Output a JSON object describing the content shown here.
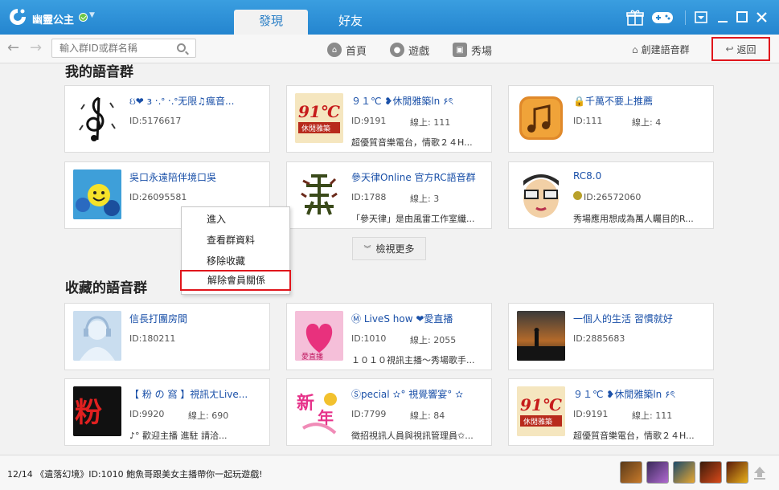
{
  "app": {
    "username": "幽靈公主",
    "logo_icon": "app-logo-icon"
  },
  "tabs": [
    {
      "label": "發現"
    },
    {
      "label": "好友"
    }
  ],
  "toolbar": {
    "search_placeholder": "輸入群ID或群名稱",
    "nav": [
      {
        "label": "首頁",
        "icon": "home-icon"
      },
      {
        "label": "遊戲",
        "icon": "gamepad-icon"
      },
      {
        "label": "秀場",
        "icon": "stage-icon"
      }
    ],
    "create_label": "創建語音群",
    "back_label": "返回"
  },
  "sections": {
    "my_groups_title": "我的語音群",
    "fav_groups_title": "收藏的語音群"
  },
  "my_groups": [
    {
      "name": "ઇ❤ ɜ ‧.ᐤ ‧.ᐤ无限♫瘋音...",
      "id": "ID:5176617",
      "online": "",
      "desc": ""
    },
    {
      "name": "９１℃ ❥休閒雅築ln ۶ৎ",
      "id": "ID:9191",
      "online": "線上: 111",
      "desc": "超優質音樂電台，情歌２４H..."
    },
    {
      "name": "🔒千萬不要上推薦",
      "id": "ID:111",
      "online": "線上: 4",
      "desc": ""
    },
    {
      "name": "吳口永遠陪伴境口吳",
      "id": "ID:26095581",
      "online": "",
      "desc": ""
    },
    {
      "name": "參天律Online 官方RC語音群",
      "id": "ID:1788",
      "online": "線上: 3",
      "desc": "「參天律」是由風雷工作室纖..."
    },
    {
      "name": "RC8.0",
      "id": "ID:26572060",
      "online": "",
      "desc": "秀場應用想成為萬人矚目的R..."
    }
  ],
  "more_label": "檢視更多",
  "context_menu": [
    {
      "label": "進入"
    },
    {
      "label": "查看群資料"
    },
    {
      "label": "移除收藏"
    },
    {
      "label": "解除會員關係"
    }
  ],
  "fav_groups": [
    {
      "name": "信長打團房間",
      "id": "ID:180211",
      "online": "",
      "desc": ""
    },
    {
      "name": "Ⓜ LiveS how ❤愛直播",
      "id": "ID:1010",
      "online": "線上: 2055",
      "desc": "１０１０視訊主播～秀場歌手..."
    },
    {
      "name": "一個人的生活 習慣就好",
      "id": "ID:2885683",
      "online": "",
      "desc": ""
    },
    {
      "name": "【 粉 の 窩 】視訊ㄤLive...",
      "id": "ID:9920",
      "online": "線上: 690",
      "desc": "♪° 歡迎主播 進駐 請洽..."
    },
    {
      "name": "Ⓢpecial ✫° 視覺響宴° ✫",
      "id": "ID:7799",
      "online": "線上: 84",
      "desc": "徵招視訊人員與視訊管理員✩..."
    },
    {
      "name": "９１℃ ❥休閒雅築ln ۶ৎ",
      "id": "ID:9191",
      "online": "線上: 111",
      "desc": "超優質音樂電台，情歌２４H..."
    }
  ],
  "status": {
    "ticker": "12/14 《遺落幻境》ID:1010 鮑魚哥跟美女主播帶你一起玩遊戲!"
  },
  "colors": {
    "titlebar": "#2a8ad6",
    "accent": "#2a7fc6",
    "link": "#1a50a8",
    "highlight_border": "#e0161c"
  }
}
